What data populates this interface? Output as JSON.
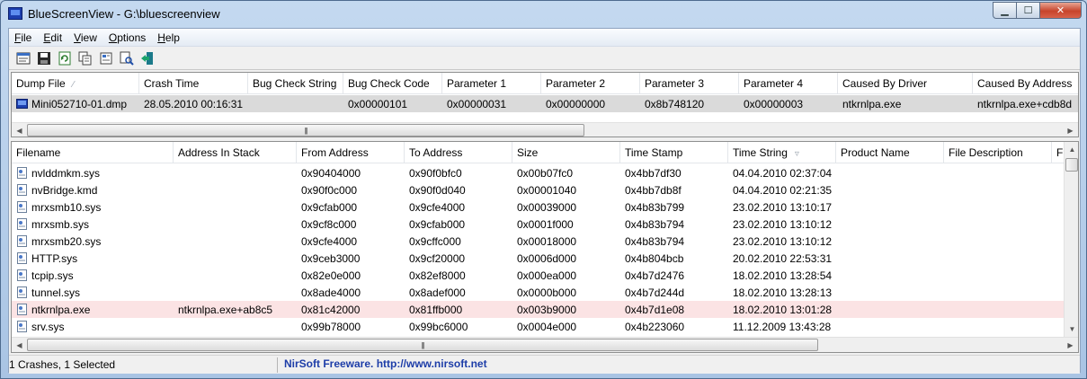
{
  "window": {
    "title": "BlueScreenView  -  G:\\bluescreenview"
  },
  "menu": [
    "File",
    "Edit",
    "View",
    "Options",
    "Help"
  ],
  "menu_underline": [
    "F",
    "E",
    "V",
    "O",
    "H"
  ],
  "toolbar": [
    "html-report-icon",
    "save-icon",
    "refresh-icon",
    "copy-icon",
    "properties-icon",
    "find-icon",
    "exit-icon"
  ],
  "dumps": {
    "columns": [
      "Dump File",
      "Crash Time",
      "Bug Check String",
      "Bug Check Code",
      "Parameter 1",
      "Parameter 2",
      "Parameter 3",
      "Parameter 4",
      "Caused By Driver",
      "Caused By Address"
    ],
    "rows": [
      [
        "Mini052710-01.dmp",
        "28.05.2010 00:16:31",
        "",
        "0x00000101",
        "0x00000031",
        "0x00000000",
        "0x8b748120",
        "0x00000003",
        "ntkrnlpa.exe",
        "ntkrnlpa.exe+cdb8d"
      ]
    ],
    "sort_column": "Dump File"
  },
  "drivers": {
    "columns": [
      "Filename",
      "Address In Stack",
      "From Address",
      "To Address",
      "Size",
      "Time Stamp",
      "Time String",
      "Product Name",
      "File Description",
      "Fil"
    ],
    "rows": [
      [
        "nvlddmkm.sys",
        "",
        "0x90404000",
        "0x90f0bfc0",
        "0x00b07fc0",
        "0x4bb7df30",
        "04.04.2010 02:37:04",
        "",
        "",
        ""
      ],
      [
        "nvBridge.kmd",
        "",
        "0x90f0c000",
        "0x90f0d040",
        "0x00001040",
        "0x4bb7db8f",
        "04.04.2010 02:21:35",
        "",
        "",
        ""
      ],
      [
        "mrxsmb10.sys",
        "",
        "0x9cfab000",
        "0x9cfe4000",
        "0x00039000",
        "0x4b83b799",
        "23.02.2010 13:10:17",
        "",
        "",
        ""
      ],
      [
        "mrxsmb.sys",
        "",
        "0x9cf8c000",
        "0x9cfab000",
        "0x0001f000",
        "0x4b83b794",
        "23.02.2010 13:10:12",
        "",
        "",
        ""
      ],
      [
        "mrxsmb20.sys",
        "",
        "0x9cfe4000",
        "0x9cffc000",
        "0x00018000",
        "0x4b83b794",
        "23.02.2010 13:10:12",
        "",
        "",
        ""
      ],
      [
        "HTTP.sys",
        "",
        "0x9ceb3000",
        "0x9cf20000",
        "0x0006d000",
        "0x4b804bcb",
        "20.02.2010 22:53:31",
        "",
        "",
        ""
      ],
      [
        "tcpip.sys",
        "",
        "0x82e0e000",
        "0x82ef8000",
        "0x000ea000",
        "0x4b7d2476",
        "18.02.2010 13:28:54",
        "",
        "",
        ""
      ],
      [
        "tunnel.sys",
        "",
        "0x8ade4000",
        "0x8adef000",
        "0x0000b000",
        "0x4b7d244d",
        "18.02.2010 13:28:13",
        "",
        "",
        ""
      ],
      [
        "ntkrnlpa.exe",
        "ntkrnlpa.exe+ab8c5",
        "0x81c42000",
        "0x81ffb000",
        "0x003b9000",
        "0x4b7d1e08",
        "18.02.2010 13:01:28",
        "",
        "",
        ""
      ],
      [
        "srv.sys",
        "",
        "0x99b78000",
        "0x99bc6000",
        "0x0004e000",
        "0x4b223060",
        "11.12.2009 13:43:28",
        "",
        "",
        ""
      ]
    ],
    "selected_row": 8,
    "sort_column": "Time String"
  },
  "status": {
    "left": "1 Crashes, 1 Selected",
    "link": "NirSoft Freeware.  http://www.nirsoft.net"
  },
  "colors": {
    "selected_row": "#fbe3e4",
    "link": "#1d3da8"
  }
}
